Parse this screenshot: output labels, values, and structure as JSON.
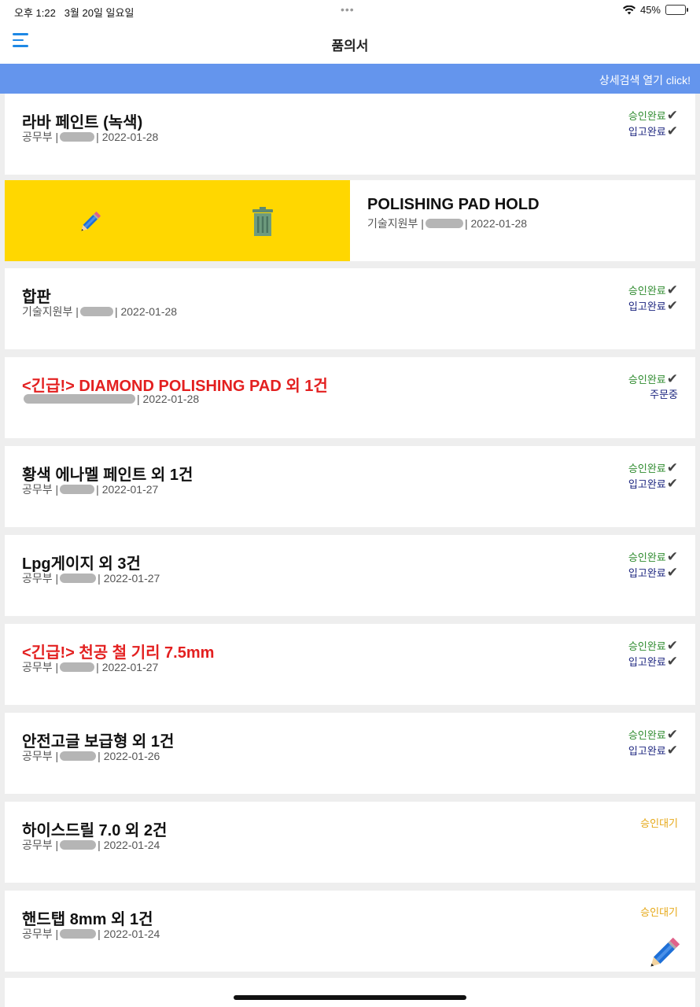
{
  "status_bar": {
    "time": "오후 1:22",
    "date": "3월 20일 일요일",
    "battery": "45%"
  },
  "header": {
    "title": "품의서"
  },
  "search_banner": {
    "label": "상세검색 열기 click!"
  },
  "items": [
    {
      "title": "라바 페인트 (녹색)",
      "dept": "공무부 |",
      "date": "| 2022-01-28",
      "approval": "승인완료",
      "receipt": "입고완료"
    },
    {
      "title": "POLISHING PAD HOLD",
      "dept": "기술지원부 |",
      "date": "| 2022-01-28"
    },
    {
      "title": "합판",
      "dept": "기술지원부 |",
      "date": "| 2022-01-28",
      "approval": "승인완료",
      "receipt": "입고완료"
    },
    {
      "title": "<긴급!> DIAMOND POLISHING PAD 외 1건",
      "dept": "",
      "date": "| 2022-01-28",
      "approval": "승인완료",
      "order": "주문중"
    },
    {
      "title": "황색 에나멜 페인트 외 1건",
      "dept": "공무부 |",
      "date": "| 2022-01-27",
      "approval": "승인완료",
      "receipt": "입고완료"
    },
    {
      "title": "Lpg게이지 외 3건",
      "dept": "공무부 |",
      "date": "| 2022-01-27",
      "approval": "승인완료",
      "receipt": "입고완료"
    },
    {
      "title": "<긴급!> 천공 철 기리 7.5mm",
      "dept": "공무부 |",
      "date": "| 2022-01-27",
      "approval": "승인완료",
      "receipt": "입고완료"
    },
    {
      "title": "안전고글 보급형 외 1건",
      "dept": "공무부 |",
      "date": "| 2022-01-26",
      "approval": "승인완료",
      "receipt": "입고완료"
    },
    {
      "title": "하이스드릴 7.0 외 2건",
      "dept": "공무부 |",
      "date": "| 2022-01-24",
      "waiting": "승인대기"
    },
    {
      "title": "핸드탭 8mm 외 1건",
      "dept": "공무부 |",
      "date": "| 2022-01-24",
      "waiting": "승인대기"
    }
  ],
  "icons": {
    "menu": "hamburger-menu-icon",
    "edit": "pencil-icon",
    "delete": "trash-icon",
    "fab": "pencil-icon",
    "check": "check-icon"
  },
  "colors": {
    "banner": "#6495ed",
    "swipe_actions": "#ffd700",
    "approved": "#2e8b2e",
    "received": "#1a237e",
    "waiting": "#e6a817",
    "urgent": "#e32020"
  }
}
